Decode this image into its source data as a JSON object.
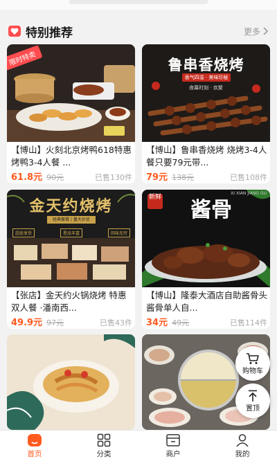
{
  "section": {
    "title": "特别推荐",
    "more_label": "更多"
  },
  "cards": [
    {
      "badge": "限时特卖",
      "title": "【博山】火刻北京烤鸭618特惠烤鸭3-4人餐 ...",
      "price": "61.8元",
      "original_price": "90元",
      "sold": "已售130件"
    },
    {
      "banner": "鲁串香烧烤",
      "banner_sub": "香气四溢 · 美味珍秘",
      "banner_sub2": "夜幕时刻 · 欢聚",
      "title": "【博山】鲁串香烧烤 烧烤3-4人餐只要79元带...",
      "price": "79元",
      "original_price": "138元",
      "sold": "已售108件"
    },
    {
      "banner": "金天约烧烤",
      "tags": [
        "经典套餐 | 量大价优"
      ],
      "tags2": [
        "超级享受",
        "星品丰富",
        "回味无穷"
      ],
      "title": "【张店】金天约火锅烧烤 特惠双人餐 ·潘南西...",
      "price": "49.9元",
      "original_price": "97元",
      "sold": "已售43件"
    },
    {
      "banner": "酱骨",
      "banner_tag": "新鲜",
      "banner_sub": "XI XIAN JIANG GU",
      "title": "【博山】隆泰大酒店自助酱骨头 酱骨单人自...",
      "price": "34元",
      "original_price": "49元",
      "sold": "已售114件"
    }
  ],
  "float_buttons": {
    "cart_label": "购物车",
    "top_label": "置顶"
  },
  "tabbar": [
    {
      "label": "首页",
      "icon": "home-icon",
      "active": true
    },
    {
      "label": "分类",
      "icon": "category-icon",
      "active": false
    },
    {
      "label": "商户",
      "icon": "shop-icon",
      "active": false
    },
    {
      "label": "我的",
      "icon": "user-icon",
      "active": false
    }
  ],
  "colors": {
    "accent": "#ff5a1f",
    "heart": "#ff4d4f"
  }
}
